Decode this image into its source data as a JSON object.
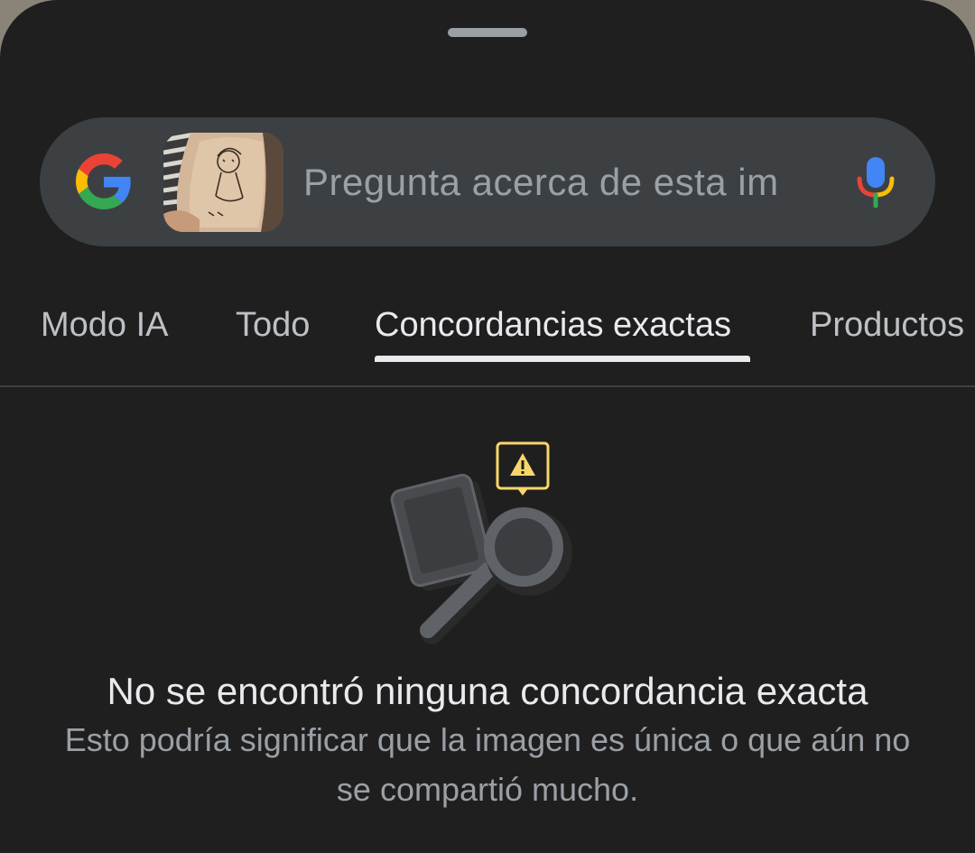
{
  "search": {
    "placeholder": "Pregunta acerca de esta im",
    "logo_icon": "google-g-icon",
    "mic_icon": "microphone-icon",
    "thumbnail_icon": "query-image-thumbnail"
  },
  "tabs": [
    {
      "label": "Modo IA",
      "active": false
    },
    {
      "label": "Todo",
      "active": false
    },
    {
      "label": "Concordancias exactas",
      "active": true
    },
    {
      "label": "Productos",
      "active": false
    }
  ],
  "empty_state": {
    "illustration_icon": "magnifier-with-warning-icon",
    "title": "No se encontró ninguna concordancia exacta",
    "description": "Esto podría significar que la imagen es única o que aún no se compartió mucho."
  },
  "colors": {
    "background": "#1f1f1f",
    "search_bar": "#3c4043",
    "text_primary": "#e8eaed",
    "text_secondary": "#9aa0a6",
    "warning_accent": "#f9d66b"
  }
}
